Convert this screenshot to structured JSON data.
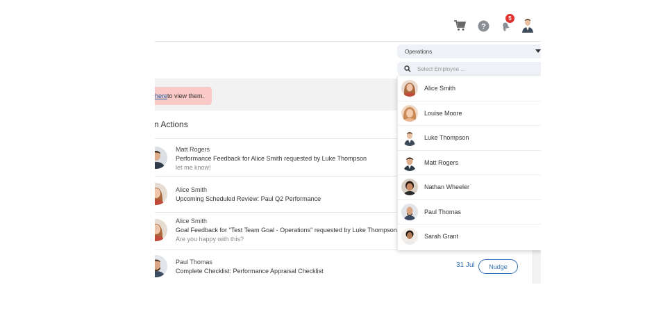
{
  "header": {
    "notification_count": "5",
    "icons": [
      "cart-icon",
      "help-icon",
      "bell-icon",
      "avatar"
    ]
  },
  "alert": {
    "link_text": "here",
    "text": " to view them."
  },
  "actions": {
    "title": "n Actions",
    "items": [
      {
        "who": "Matt Rogers",
        "what": "Performance Feedback for Alice Smith requested by Luke Thompson",
        "note": "let me know!"
      },
      {
        "who": "Alice Smith",
        "what": "Upcoming Scheduled Review: Paul Q2 Performance",
        "note": ""
      },
      {
        "who": "Alice Smith",
        "what": "Goal Feedback for \"Test Team Goal - Operations\" requested by Luke Thompson",
        "note": "Are you happy with this?"
      },
      {
        "who": "Paul Thomas",
        "what": "Complete Checklist: Performance Appraisal Checklist",
        "note": "",
        "date": "31 Jul",
        "button": "Nudge"
      }
    ]
  },
  "dropdown": {
    "department": "Operations",
    "search_placeholder": "Select Employee ...",
    "employees": [
      "Alice Smith",
      "Louise Moore",
      "Luke Thompson",
      "Matt Rogers",
      "Nathan Wheeler",
      "Paul Thomas",
      "Sarah Grant"
    ]
  },
  "colors": {
    "accent": "#2f6fb2",
    "alert_bg": "#f8c9c6",
    "badge": "#e0332f"
  }
}
